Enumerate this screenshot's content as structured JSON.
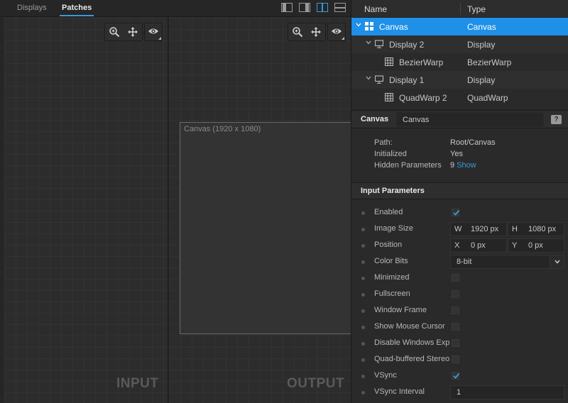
{
  "tabs": {
    "displays": "Displays",
    "patches": "Patches"
  },
  "panes": {
    "input_label": "INPUT",
    "output_label": "OUTPUT",
    "canvas_label": "Canvas (1920 x 1080)"
  },
  "tree": {
    "header_name": "Name",
    "header_type": "Type",
    "rows": [
      {
        "name": "Canvas",
        "type": "Canvas"
      },
      {
        "name": "Display 2",
        "type": "Display"
      },
      {
        "name": "BezierWarp",
        "type": "BezierWarp"
      },
      {
        "name": "Display 1",
        "type": "Display"
      },
      {
        "name": "QuadWarp 2",
        "type": "QuadWarp"
      }
    ]
  },
  "properties": {
    "title": "Canvas",
    "name_value": "Canvas",
    "help": "?",
    "path_label": "Path:",
    "path_value": "Root/Canvas",
    "initialized_label": "Initialized",
    "initialized_value": "Yes",
    "hidden_label": "Hidden Parameters",
    "hidden_count": "9",
    "hidden_link": "Show"
  },
  "input_params": {
    "title": "Input Parameters",
    "enabled": "Enabled",
    "image_size": "Image Size",
    "w_label": "W",
    "w_value": "1920 px",
    "h_label": "H",
    "h_value": "1080 px",
    "position": "Position",
    "x_label": "X",
    "x_value": "0 px",
    "y_label": "Y",
    "y_value": "0 px",
    "color_bits": "Color Bits",
    "color_bits_value": "8-bit",
    "minimized": "Minimized",
    "fullscreen": "Fullscreen",
    "window_frame": "Window Frame",
    "show_mouse_cursor": "Show Mouse Cursor",
    "disable_windows_exp": "Disable Windows Exp",
    "quad_buffered_stereo": "Quad-buffered Stereo",
    "vsync": "VSync",
    "vsync_interval": "VSync Interval",
    "vsync_interval_value": "1",
    "checked": {
      "enabled": true,
      "minimized": false,
      "fullscreen": false,
      "window_frame": false,
      "show_mouse_cursor": false,
      "disable_windows_exp": false,
      "quad_buffered_stereo": false,
      "vsync": true
    }
  },
  "colors": {
    "accent": "#1e90e8",
    "link": "#3a9ad9"
  }
}
